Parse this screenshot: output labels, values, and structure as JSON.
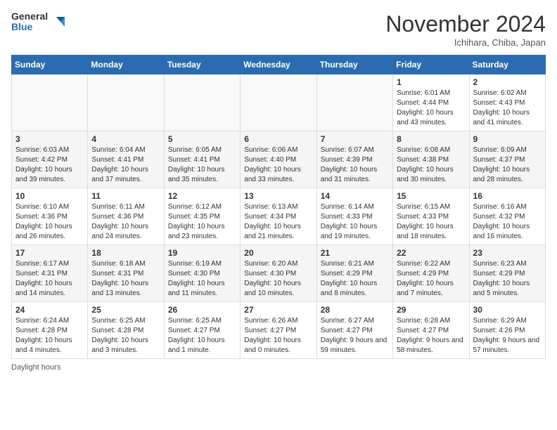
{
  "header": {
    "logo_general": "General",
    "logo_blue": "Blue",
    "month_title": "November 2024",
    "location": "Ichihara, Chiba, Japan"
  },
  "days_of_week": [
    "Sunday",
    "Monday",
    "Tuesday",
    "Wednesday",
    "Thursday",
    "Friday",
    "Saturday"
  ],
  "weeks": [
    {
      "days": [
        {
          "num": "",
          "info": ""
        },
        {
          "num": "",
          "info": ""
        },
        {
          "num": "",
          "info": ""
        },
        {
          "num": "",
          "info": ""
        },
        {
          "num": "",
          "info": ""
        },
        {
          "num": "1",
          "info": "Sunrise: 6:01 AM\nSunset: 4:44 PM\nDaylight: 10 hours and 43 minutes."
        },
        {
          "num": "2",
          "info": "Sunrise: 6:02 AM\nSunset: 4:43 PM\nDaylight: 10 hours and 41 minutes."
        }
      ]
    },
    {
      "days": [
        {
          "num": "3",
          "info": "Sunrise: 6:03 AM\nSunset: 4:42 PM\nDaylight: 10 hours and 39 minutes."
        },
        {
          "num": "4",
          "info": "Sunrise: 6:04 AM\nSunset: 4:41 PM\nDaylight: 10 hours and 37 minutes."
        },
        {
          "num": "5",
          "info": "Sunrise: 6:05 AM\nSunset: 4:41 PM\nDaylight: 10 hours and 35 minutes."
        },
        {
          "num": "6",
          "info": "Sunrise: 6:06 AM\nSunset: 4:40 PM\nDaylight: 10 hours and 33 minutes."
        },
        {
          "num": "7",
          "info": "Sunrise: 6:07 AM\nSunset: 4:39 PM\nDaylight: 10 hours and 31 minutes."
        },
        {
          "num": "8",
          "info": "Sunrise: 6:08 AM\nSunset: 4:38 PM\nDaylight: 10 hours and 30 minutes."
        },
        {
          "num": "9",
          "info": "Sunrise: 6:09 AM\nSunset: 4:37 PM\nDaylight: 10 hours and 28 minutes."
        }
      ]
    },
    {
      "days": [
        {
          "num": "10",
          "info": "Sunrise: 6:10 AM\nSunset: 4:36 PM\nDaylight: 10 hours and 26 minutes."
        },
        {
          "num": "11",
          "info": "Sunrise: 6:11 AM\nSunset: 4:36 PM\nDaylight: 10 hours and 24 minutes."
        },
        {
          "num": "12",
          "info": "Sunrise: 6:12 AM\nSunset: 4:35 PM\nDaylight: 10 hours and 23 minutes."
        },
        {
          "num": "13",
          "info": "Sunrise: 6:13 AM\nSunset: 4:34 PM\nDaylight: 10 hours and 21 minutes."
        },
        {
          "num": "14",
          "info": "Sunrise: 6:14 AM\nSunset: 4:33 PM\nDaylight: 10 hours and 19 minutes."
        },
        {
          "num": "15",
          "info": "Sunrise: 6:15 AM\nSunset: 4:33 PM\nDaylight: 10 hours and 18 minutes."
        },
        {
          "num": "16",
          "info": "Sunrise: 6:16 AM\nSunset: 4:32 PM\nDaylight: 10 hours and 16 minutes."
        }
      ]
    },
    {
      "days": [
        {
          "num": "17",
          "info": "Sunrise: 6:17 AM\nSunset: 4:31 PM\nDaylight: 10 hours and 14 minutes."
        },
        {
          "num": "18",
          "info": "Sunrise: 6:18 AM\nSunset: 4:31 PM\nDaylight: 10 hours and 13 minutes."
        },
        {
          "num": "19",
          "info": "Sunrise: 6:19 AM\nSunset: 4:30 PM\nDaylight: 10 hours and 11 minutes."
        },
        {
          "num": "20",
          "info": "Sunrise: 6:20 AM\nSunset: 4:30 PM\nDaylight: 10 hours and 10 minutes."
        },
        {
          "num": "21",
          "info": "Sunrise: 6:21 AM\nSunset: 4:29 PM\nDaylight: 10 hours and 8 minutes."
        },
        {
          "num": "22",
          "info": "Sunrise: 6:22 AM\nSunset: 4:29 PM\nDaylight: 10 hours and 7 minutes."
        },
        {
          "num": "23",
          "info": "Sunrise: 6:23 AM\nSunset: 4:29 PM\nDaylight: 10 hours and 5 minutes."
        }
      ]
    },
    {
      "days": [
        {
          "num": "24",
          "info": "Sunrise: 6:24 AM\nSunset: 4:28 PM\nDaylight: 10 hours and 4 minutes."
        },
        {
          "num": "25",
          "info": "Sunrise: 6:25 AM\nSunset: 4:28 PM\nDaylight: 10 hours and 3 minutes."
        },
        {
          "num": "26",
          "info": "Sunrise: 6:25 AM\nSunset: 4:27 PM\nDaylight: 10 hours and 1 minute."
        },
        {
          "num": "27",
          "info": "Sunrise: 6:26 AM\nSunset: 4:27 PM\nDaylight: 10 hours and 0 minutes."
        },
        {
          "num": "28",
          "info": "Sunrise: 6:27 AM\nSunset: 4:27 PM\nDaylight: 9 hours and 59 minutes."
        },
        {
          "num": "29",
          "info": "Sunrise: 6:28 AM\nSunset: 4:27 PM\nDaylight: 9 hours and 58 minutes."
        },
        {
          "num": "30",
          "info": "Sunrise: 6:29 AM\nSunset: 4:26 PM\nDaylight: 9 hours and 57 minutes."
        }
      ]
    }
  ],
  "footer": {
    "note": "Daylight hours"
  }
}
